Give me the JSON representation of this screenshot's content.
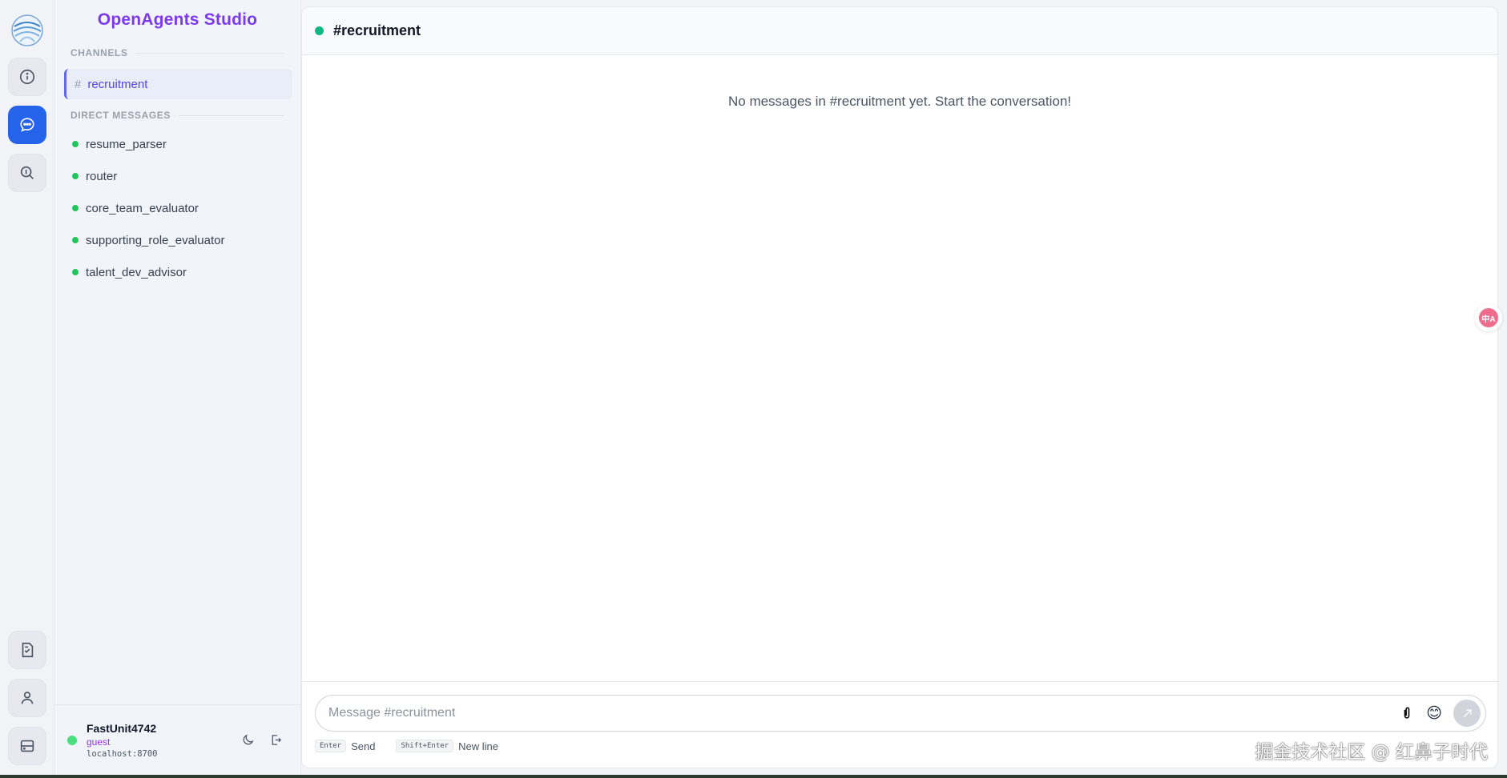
{
  "app": {
    "title": "OpenAgents Studio"
  },
  "rail": {
    "top_icons": [
      "logo-icon",
      "info-icon",
      "chat-icon",
      "search-agent-icon"
    ],
    "bottom_icons": [
      "document-icon",
      "user-icon",
      "storage-icon"
    ],
    "active": "chat-icon"
  },
  "sidebar": {
    "channels_label": "CHANNELS",
    "channels": [
      {
        "hash": "#",
        "name": "recruitment"
      }
    ],
    "dm_label": "DIRECT MESSAGES",
    "direct_messages": [
      {
        "name": "resume_parser"
      },
      {
        "name": "router"
      },
      {
        "name": "core_team_evaluator"
      },
      {
        "name": "supporting_role_evaluator"
      },
      {
        "name": "talent_dev_advisor"
      }
    ]
  },
  "user": {
    "name": "FastUnit4742",
    "role": "guest",
    "host": "localhost:8700"
  },
  "main": {
    "channel_title": "#recruitment",
    "empty_message": "No messages in #recruitment yet. Start the conversation!",
    "composer_placeholder": "Message #recruitment",
    "emoji": "😊",
    "hints": {
      "enter_key": "Enter",
      "enter_label": "Send",
      "shift_enter_key": "Shift+Enter",
      "shift_enter_label": "New line"
    }
  },
  "translate_widget": {
    "label": "中A"
  },
  "watermark": "掘金技术社区 @ 红鼻子时代",
  "colors": {
    "brand": "#7c3aed",
    "active_rail": "#2563eb",
    "online": "#22c55e",
    "channel_active": "#4f46e5"
  }
}
